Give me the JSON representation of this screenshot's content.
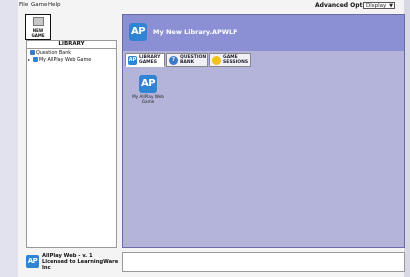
{
  "menu": {
    "file": "File",
    "game": "Game",
    "help": "Help"
  },
  "advanced": {
    "label": "Advanced Options",
    "selected": "Display"
  },
  "new_game": {
    "label": "NEW\nGAME"
  },
  "library": {
    "header": "LIBRARY",
    "items": [
      {
        "label": "Question Bank",
        "icon": "question-bank-icon"
      },
      {
        "label": "My AllPlay Web Game",
        "icon": "game-icon"
      }
    ]
  },
  "main": {
    "logo": "AP",
    "title": "My New Library.APWLF",
    "tabs": [
      {
        "label": "LIBRARY\nGAMES",
        "icon": "library-games-icon",
        "icon_text": "AP"
      },
      {
        "label": "QUESTION\nBANK",
        "icon": "question-icon",
        "icon_text": "?"
      },
      {
        "label": "GAME\nSESSIONS",
        "icon": "game-sessions-icon",
        "icon_text": ""
      }
    ],
    "game": {
      "icon_text": "AP",
      "label": "My AllPlay Web\nGame"
    }
  },
  "about": {
    "logo": "AP",
    "text": "AllPlay Web - v. 1\nLicensed to LearningWare\nInc"
  },
  "colors": {
    "header": "#8b90d4",
    "content": "#b4b4da",
    "accent": "#2f84d4"
  }
}
